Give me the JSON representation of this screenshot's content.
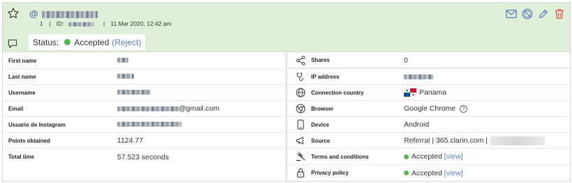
{
  "header": {
    "at_symbol": "@",
    "meta_index": "1",
    "meta_sep1": "|",
    "meta_id_label": "ID:",
    "meta_sep2": "|",
    "meta_date": "11 Mar 2020, 12:42 am",
    "icons": [
      "mail-icon",
      "block-icon",
      "edit-icon",
      "trash-icon"
    ],
    "status_label": "Status:",
    "status_value": "Accepted",
    "status_action": "(Reject)"
  },
  "left": [
    {
      "label": "First name"
    },
    {
      "label": "Last name"
    },
    {
      "label": "Username"
    },
    {
      "label": "Email",
      "value": "@gmail.com"
    },
    {
      "label": "Usuario de Instagram"
    },
    {
      "label": "Points obtained",
      "value": "1124.77"
    },
    {
      "label": "Total time",
      "value": "57.523 seconds"
    }
  ],
  "right": [
    {
      "icon": "share-icon",
      "label": "Shares",
      "value": "0"
    },
    {
      "icon": "plug-icon",
      "label": "IP address"
    },
    {
      "icon": "globe-icon",
      "label": "Connection country",
      "value": "Panama"
    },
    {
      "icon": "chrome-icon",
      "label": "Browser",
      "value": "Google Chrome",
      "help": "?"
    },
    {
      "icon": "device-icon",
      "label": "Device",
      "value": "Android"
    },
    {
      "icon": "megaphone-icon",
      "label": "Source",
      "value": "Referral | 365.clarin.com |"
    },
    {
      "icon": "gavel-icon",
      "label": "Terms and conditions",
      "value": "Accepted",
      "link": "[view]"
    },
    {
      "icon": "lock-icon",
      "label": "Privacy policy",
      "value": "Accepted",
      "link": "[view]"
    }
  ],
  "colors": {
    "header_bg": "#dff0d8",
    "accent": "#5b7bc0",
    "accepted": "#55b84e",
    "delete": "#d9534f"
  }
}
